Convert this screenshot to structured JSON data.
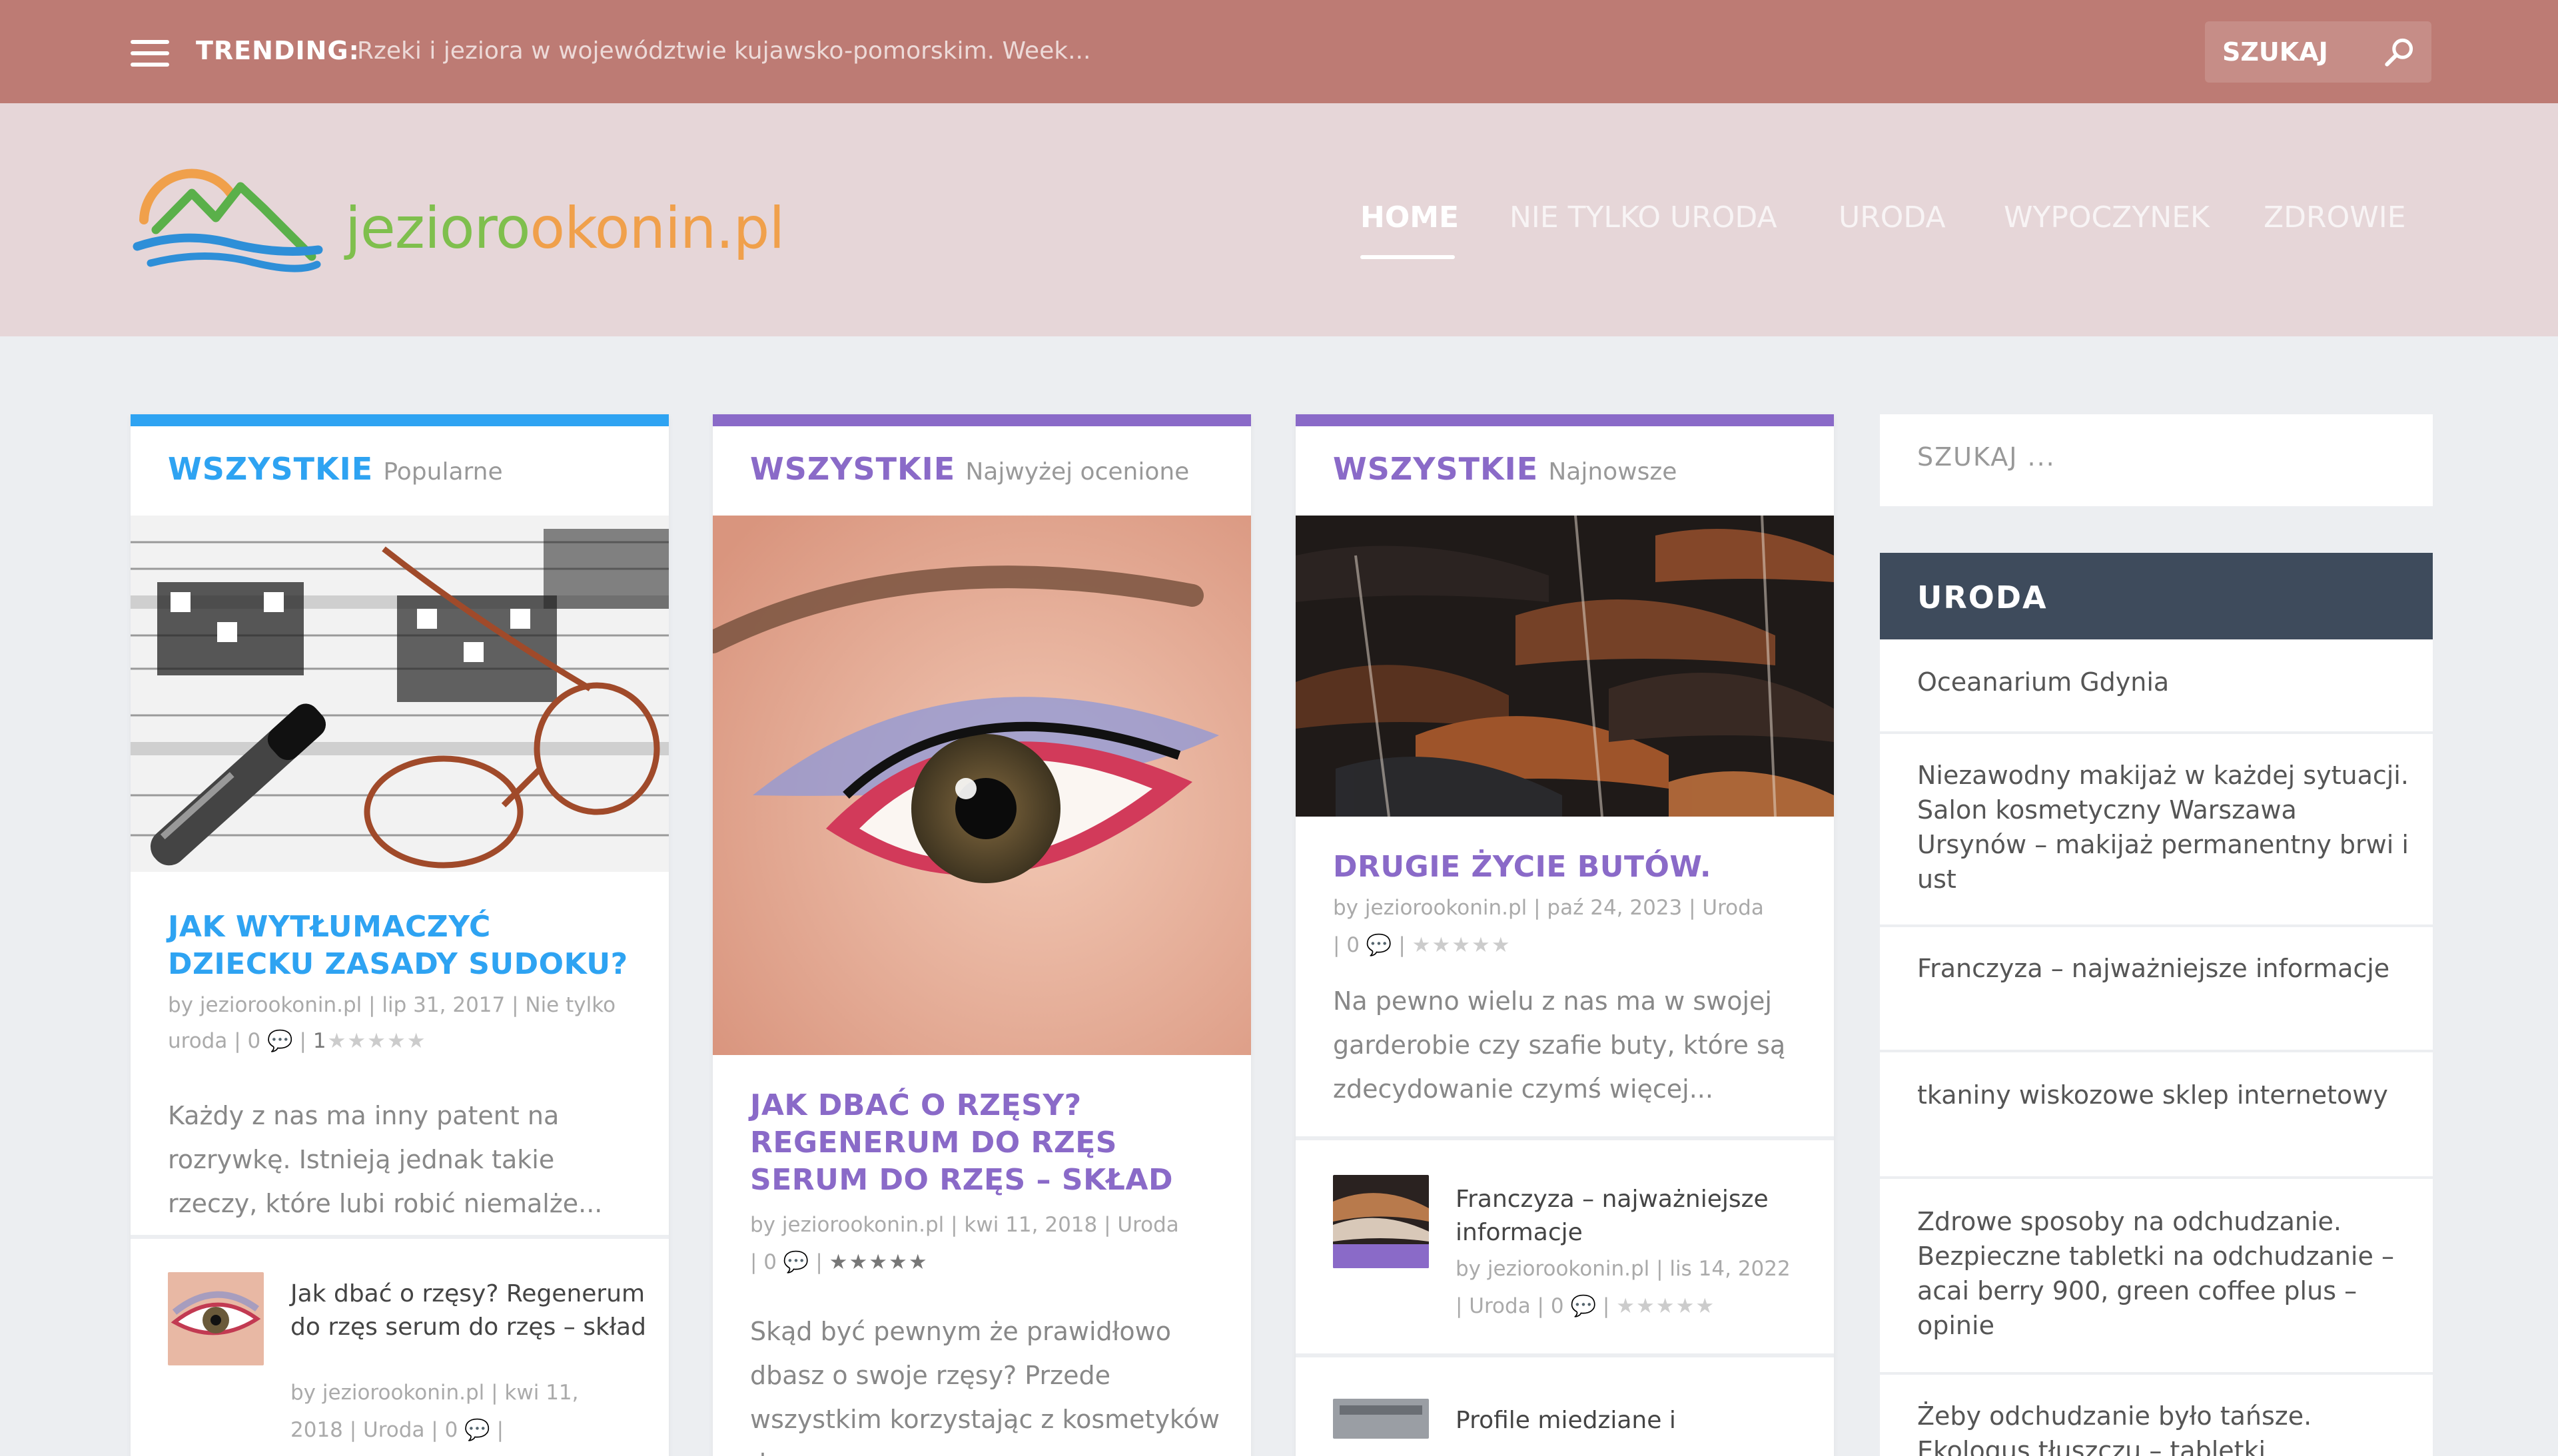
{
  "topbar": {
    "trending_label": "TRENDING:",
    "trending_text": "Rzeki i jeziora w województwie kujawsko-pomorskim. Week...",
    "search_label": "SZUKAJ"
  },
  "logo": {
    "part1": "jezioro",
    "part2": "okonin.pl"
  },
  "nav": [
    "HOME",
    "NIE TYLKO URODA",
    "URODA",
    "WYPOCZYNEK",
    "ZDROWIE"
  ],
  "cards": [
    {
      "category": "WSZYSTKIE",
      "subtitle": "Popularne",
      "accent": "#2ea3f2",
      "title": "JAK WYTŁUMACZYĆ DZIECKU ZASADY SUDOKU?",
      "meta_line1": "by jeziorookonin.pl | lip 31, 2017 | Nie tylko",
      "meta_line2_text": "uroda | 0 ",
      "meta_line2_rating": "1",
      "excerpt": "Każdy z nas ma inny patent na rozrywkę. Istnieją jednak takie rzeczy, które lubi robić niemalże...",
      "mini": {
        "title": "Jak dbać o rzęsy? Regenerum do rzęs serum do rzęs – skład",
        "meta_line1": "by jeziorookonin.pl | kwi 11,",
        "meta_line2": "2018 | Uroda | 0 "
      }
    },
    {
      "category": "WSZYSTKIE",
      "subtitle": "Najwyżej ocenione",
      "accent": "#8a6ac8",
      "title": "JAK DBAĆ O RZĘSY? REGENERUM DO RZĘS SERUM DO RZĘS – SKŁAD",
      "meta_line1": "by jeziorookonin.pl | kwi 11, 2018 | Uroda",
      "meta_line2_text": "| 0 ",
      "excerpt": "Skąd być pewnym że prawidłowo dbasz o swoje rzęsy? Przede wszystkim korzystając z kosmetyków do..."
    },
    {
      "category": "WSZYSTKIE",
      "subtitle": "Najnowsze",
      "accent": "#8a6ac8",
      "title": "DRUGIE ŻYCIE BUTÓW.",
      "meta_line1": "by jeziorookonin.pl | paź 24, 2023 | Uroda",
      "meta_line2_text": "| 0 ",
      "excerpt": "Na pewno wielu z nas ma w swojej garderobie czy szafie buty, które są zdecydowanie czymś więcej...",
      "mini": {
        "title": "Franczyza – najważniejsze informacje",
        "meta_line1": "by jeziorookonin.pl | lis 14, 2022",
        "meta_line2": "| Uroda | 0 "
      },
      "mini2": {
        "title": "Profile miedziane i"
      }
    }
  ],
  "sidebar": {
    "search_placeholder": "SZUKAJ ...",
    "widget_title": "URODA",
    "items": [
      "Oceanarium Gdynia",
      "Niezawodny makijaż w każdej sytuacji. Salon kosmetyczny Warszawa Ursynów – makijaż permanentny brwi i ust",
      "Franczyza – najważniejsze informacje",
      "tkaniny wiskozowe sklep internetowy",
      "Zdrowe sposoby na odchudzanie. Bezpieczne tabletki na odchudzanie – acai berry 900, green coffee plus – opinie",
      "Żeby odchudzanie było tańsze. Ekologus tłuszczu – tabletki"
    ]
  },
  "icons": {
    "menu": "hamburger-menu-icon",
    "search": "search-icon",
    "comment": "comment-icon",
    "star": "star-icon"
  }
}
